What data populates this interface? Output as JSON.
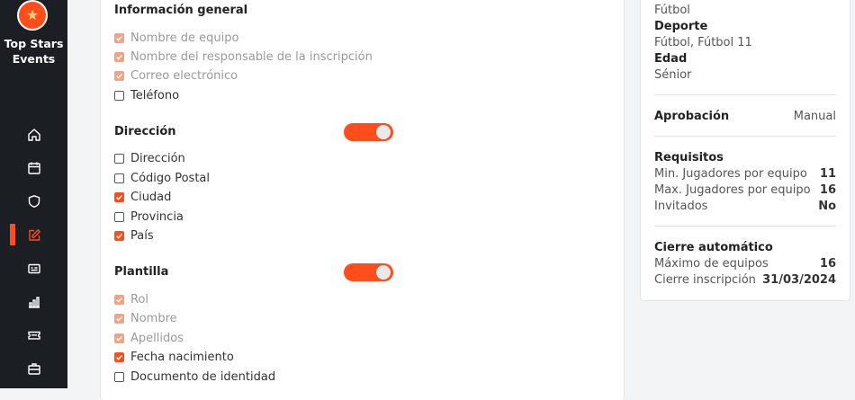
{
  "sidebar": {
    "brand_line1": "Top Stars",
    "brand_line2": "Events",
    "items": [
      {
        "icon": "home-icon"
      },
      {
        "icon": "calendar-icon"
      },
      {
        "icon": "shield-icon"
      },
      {
        "icon": "edit-icon"
      },
      {
        "icon": "id-card-icon"
      },
      {
        "icon": "bar-chart-icon"
      },
      {
        "icon": "ticket-icon"
      },
      {
        "icon": "briefcase-icon"
      }
    ],
    "active_color": "#ff4d1c"
  },
  "form": {
    "general": {
      "title": "Información general",
      "fields": [
        {
          "label": "Nombre de equipo",
          "checked": true,
          "disabled": true
        },
        {
          "label": "Nombre del responsable de la inscripción",
          "checked": true,
          "disabled": true
        },
        {
          "label": "Correo electrónico",
          "checked": true,
          "disabled": true
        },
        {
          "label": "Teléfono",
          "checked": false,
          "disabled": false
        }
      ]
    },
    "direccion": {
      "title": "Dirección",
      "enabled": true,
      "fields": [
        {
          "label": "Dirección",
          "checked": false,
          "disabled": false
        },
        {
          "label": "Código Postal",
          "checked": false,
          "disabled": false
        },
        {
          "label": "Ciudad",
          "checked": true,
          "disabled": false
        },
        {
          "label": "Provincia",
          "checked": false,
          "disabled": false
        },
        {
          "label": "País",
          "checked": true,
          "disabled": false
        }
      ]
    },
    "plantilla": {
      "title": "Plantilla",
      "enabled": true,
      "fields": [
        {
          "label": "Rol",
          "checked": true,
          "disabled": true
        },
        {
          "label": "Nombre",
          "checked": true,
          "disabled": true
        },
        {
          "label": "Apellidos",
          "checked": true,
          "disabled": true
        },
        {
          "label": "Fecha nacimiento",
          "checked": true,
          "disabled": false
        },
        {
          "label": "Documento de identidad",
          "checked": false,
          "disabled": false
        }
      ]
    }
  },
  "summary": {
    "sport_type": "Fútbol",
    "deporte_label": "Deporte",
    "deporte_value": "Fútbol, Fútbol 11",
    "edad_label": "Edad",
    "edad_value": "Sénior",
    "aprobacion_label": "Aprobación",
    "aprobacion_value": "Manual",
    "requisitos_title": "Requisitos",
    "requisitos": [
      {
        "label": "Min. Jugadores por equipo",
        "value": "11"
      },
      {
        "label": "Max. Jugadores por equipo",
        "value": "16"
      },
      {
        "label": "Invitados",
        "value": "No"
      }
    ],
    "cierre_title": "Cierre automático",
    "cierre": [
      {
        "label": "Máximo de equipos",
        "value": "16"
      },
      {
        "label": "Cierre inscripción",
        "value": "31/03/2024"
      }
    ]
  }
}
